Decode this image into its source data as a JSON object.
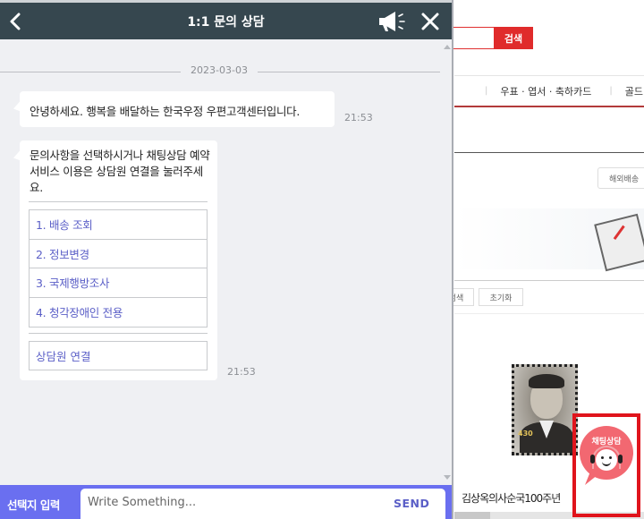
{
  "chat": {
    "title": "1:1 문의 상담",
    "icons": {
      "back": "chevron-left-icon",
      "notice": "megaphone-icon",
      "close": "close-icon"
    },
    "date": "2023-03-03",
    "messages": [
      {
        "text": "안녕하세요. 행복을 배달하는 한국우정 우편고객센터입니다.",
        "time": "21:53"
      },
      {
        "text": "문의사항을 선택하시거나 채팅상담 예약 서비스 이용은 상담원 연결을 눌러주세요.",
        "time": "21:53",
        "options": [
          "1. 배송 조회",
          "2. 정보변경",
          "3. 국제행방조사",
          "4. 청각장애인 전용"
        ],
        "agent_button": "상담원 연결"
      }
    ],
    "input": {
      "label": "선택지 입력",
      "placeholder": "Write Something...",
      "value": "",
      "send_label": "SEND"
    },
    "colors": {
      "header": "#36474f",
      "accent": "#6a6ff0",
      "link": "#5b5fc7",
      "background": "#eff0f3"
    }
  },
  "site": {
    "search_button": "검색",
    "nav": [
      "우표 · 엽서 · 축하카드",
      "골드"
    ],
    "shipping_button": "해외배송 ",
    "filter_buttons": [
      "검색",
      "초기화"
    ],
    "product_title": "김상옥의사순국100주년",
    "stamp_value": "430",
    "chat_launcher_label": "채팅상담",
    "colors": {
      "brand_red": "#e02b2b",
      "launcher": "#f26871",
      "highlight": "#e0141c"
    }
  }
}
